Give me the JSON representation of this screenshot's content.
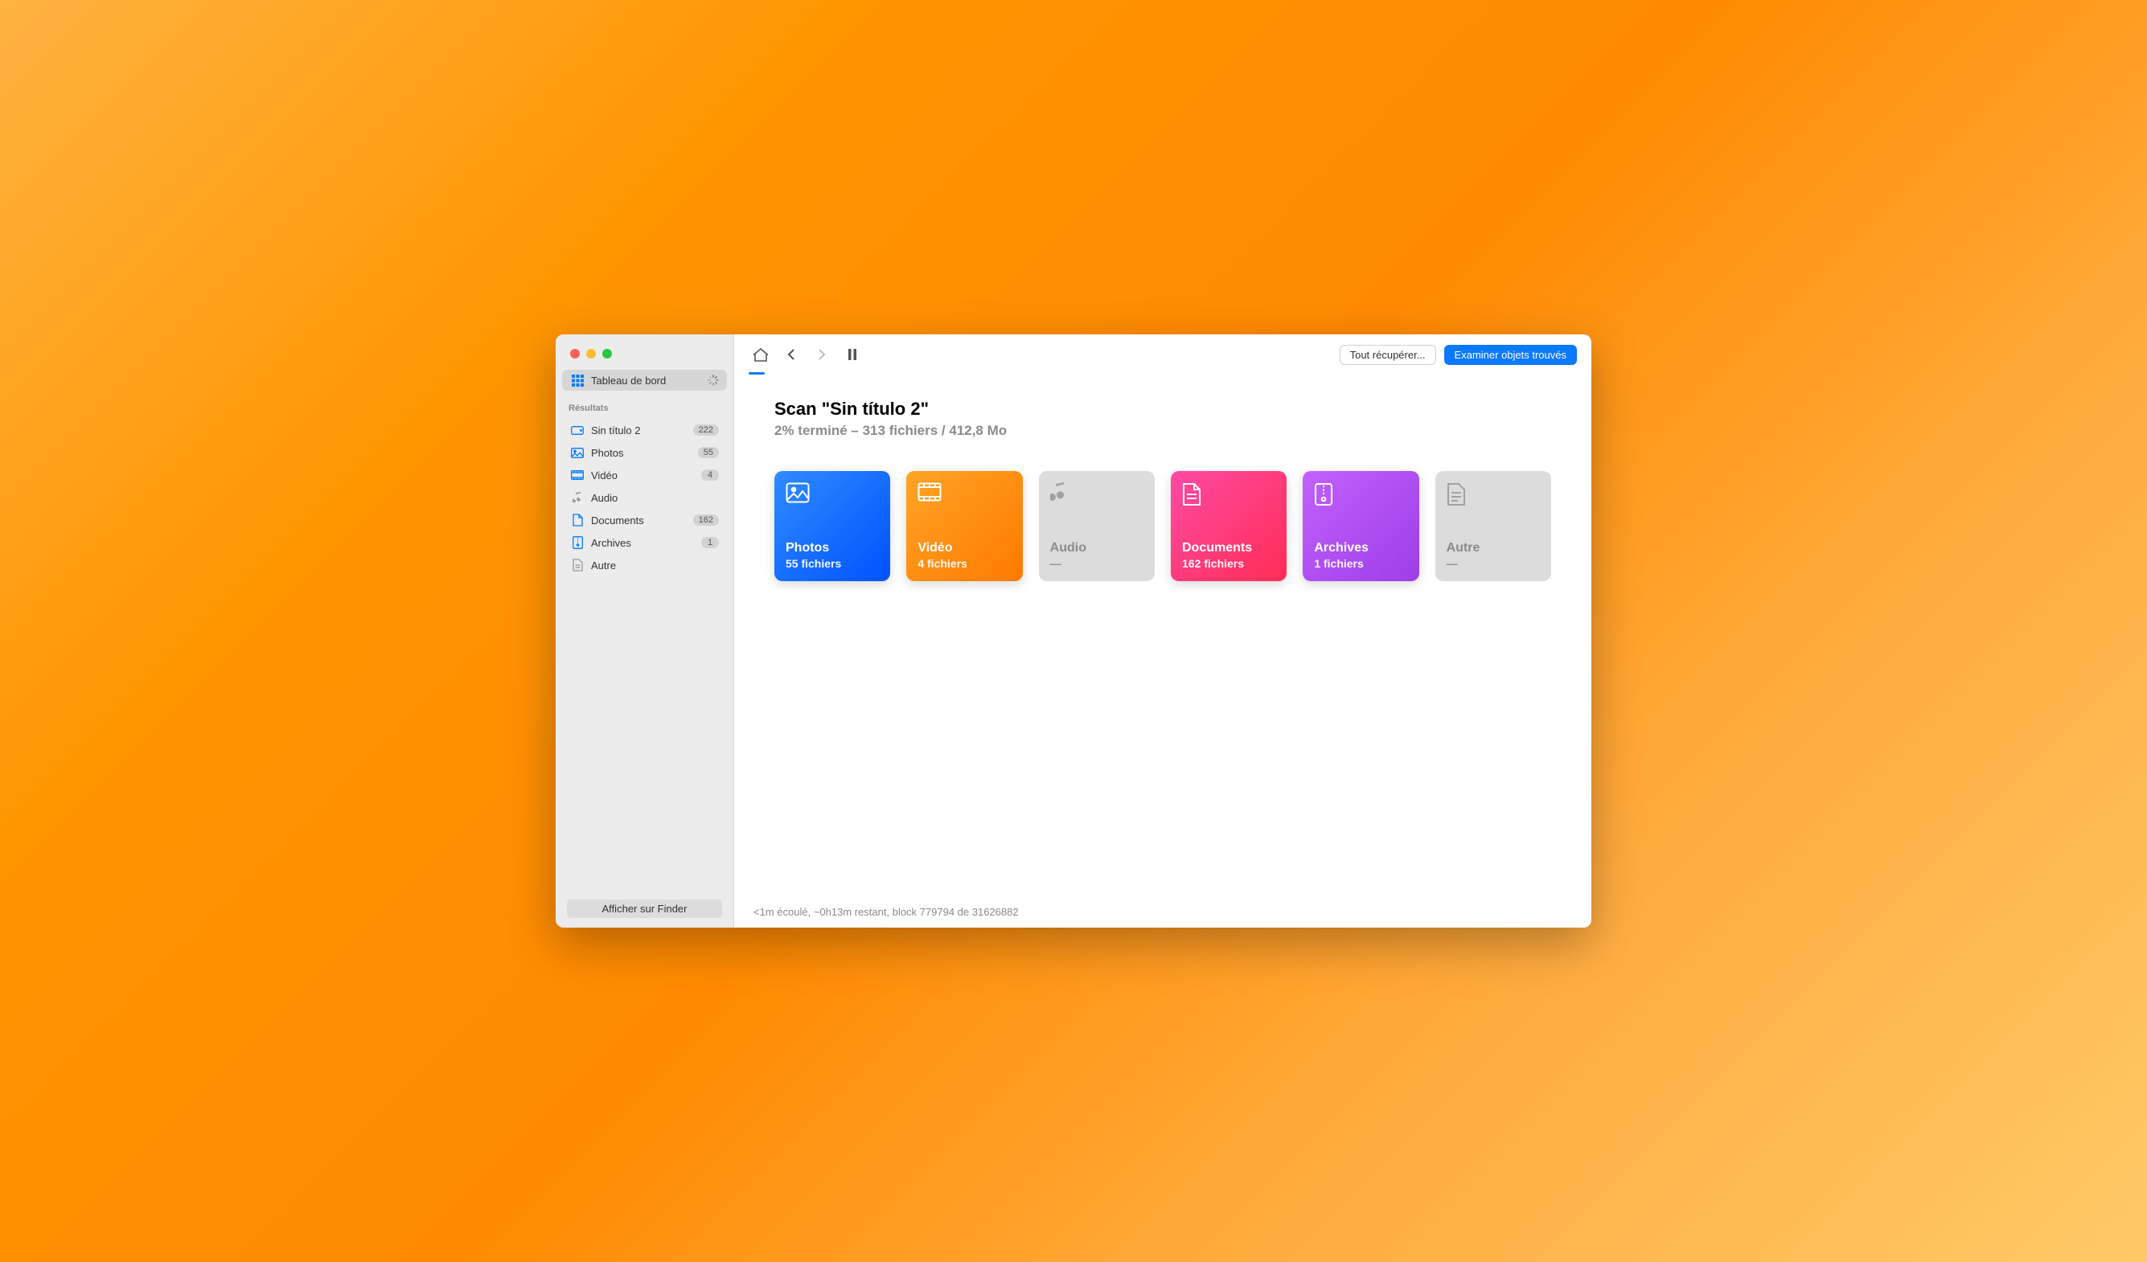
{
  "sidebar": {
    "dashboard_label": "Tableau de bord",
    "section_results": "Résultats",
    "items": [
      {
        "label": "Sin título 2",
        "badge": "222"
      },
      {
        "label": "Photos",
        "badge": "55"
      },
      {
        "label": "Vidéo",
        "badge": "4"
      },
      {
        "label": "Audio",
        "badge": ""
      },
      {
        "label": "Documents",
        "badge": "162"
      },
      {
        "label": "Archives",
        "badge": "1"
      },
      {
        "label": "Autre",
        "badge": ""
      }
    ],
    "finder_button": "Afficher sur Finder"
  },
  "toolbar": {
    "recover_all": "Tout récupérer...",
    "review_found": "Examiner objets trouvés"
  },
  "main": {
    "title": "Scan \"Sin título 2\"",
    "subtitle": "2% terminé – 313 fichiers / 412,8 Mo"
  },
  "cards": [
    {
      "title": "Photos",
      "sub": "55 fichiers"
    },
    {
      "title": "Vidéo",
      "sub": "4 fichiers"
    },
    {
      "title": "Audio",
      "sub": "—"
    },
    {
      "title": "Documents",
      "sub": "162 fichiers"
    },
    {
      "title": "Archives",
      "sub": "1 fichiers"
    },
    {
      "title": "Autre",
      "sub": "—"
    }
  ],
  "status": {
    "text": "<1m écoulé, ~0h13m restant, block 779794 de 31626882"
  }
}
